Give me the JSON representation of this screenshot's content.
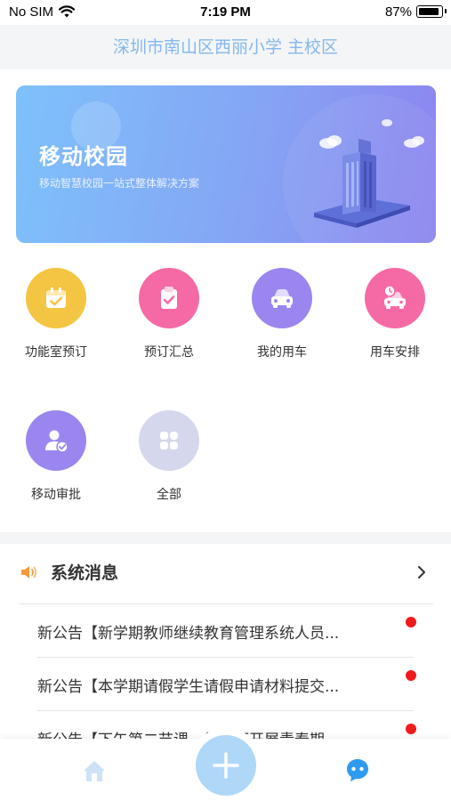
{
  "status_bar": {
    "carrier": "No SIM",
    "time": "7:19 PM",
    "battery": "87%"
  },
  "header": {
    "title": "深圳市南山区西丽小学 主校区"
  },
  "banner": {
    "title": "移动校园",
    "subtitle": "移动智慧校园一站式整体解决方案"
  },
  "functions": [
    {
      "label": "功能室预订",
      "icon": "calendar-check-icon",
      "color": "#f4c542"
    },
    {
      "label": "预订汇总",
      "icon": "clipboard-check-icon",
      "color": "#f56aa5"
    },
    {
      "label": "我的用车",
      "icon": "car-icon",
      "color": "#9b86f0"
    },
    {
      "label": "用车安排",
      "icon": "car-clock-icon",
      "color": "#f56aa5"
    },
    {
      "label": "移动审批",
      "icon": "user-approve-icon",
      "color": "#9b86f0"
    },
    {
      "label": "全部",
      "icon": "grid-icon",
      "color": "#d5d7ec"
    }
  ],
  "news": {
    "title": "系统消息",
    "items": [
      {
        "text": "新公告【新学期教师继续教育管理系统人员..."
      },
      {
        "text": "新公告【本学期请假学生请假申请材料提交..."
      },
      {
        "text": "新公告【下午第二节课，德邻厅开展青春期..."
      }
    ]
  },
  "tabbar": {
    "items": [
      "home-icon",
      "add-icon",
      "chat-icon"
    ],
    "accent": "#2f9bf0"
  }
}
